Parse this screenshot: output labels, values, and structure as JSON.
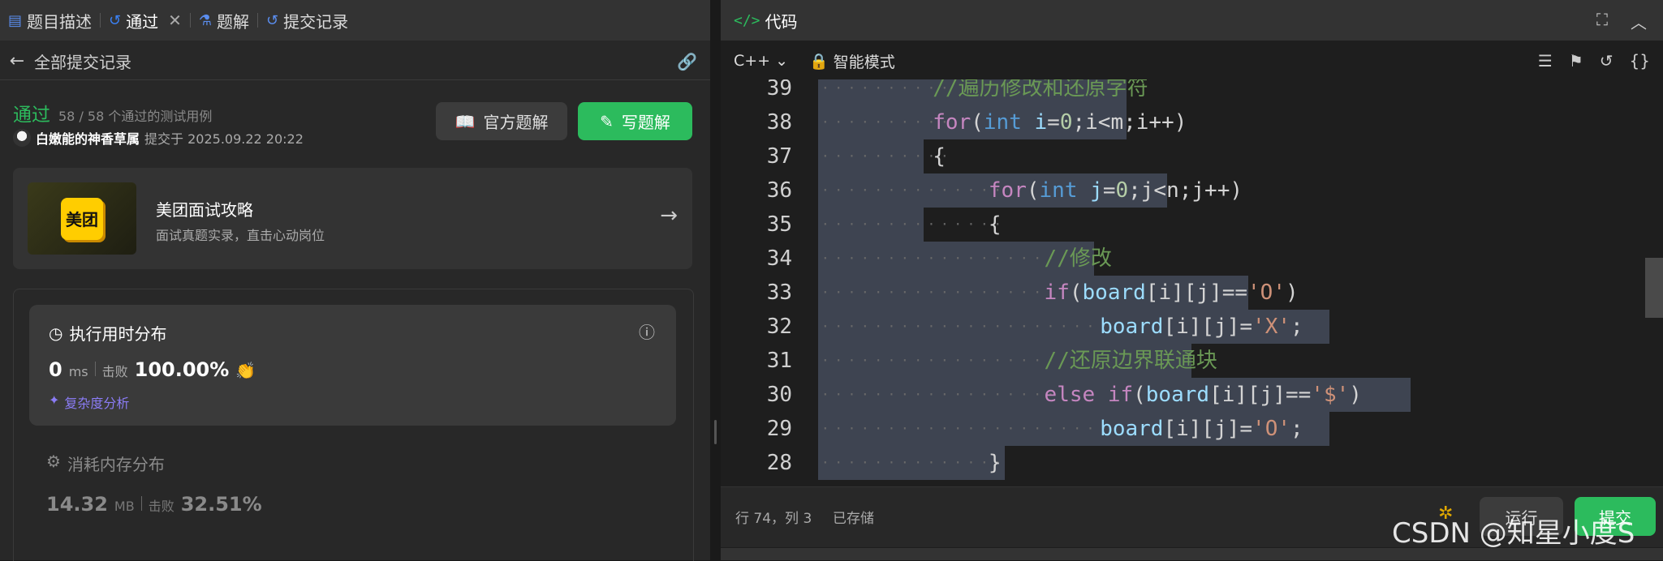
{
  "left_tabs": [
    {
      "label": "题目描述",
      "icon": "description-icon"
    },
    {
      "label": "通过",
      "icon": "history-icon"
    },
    {
      "label": "题解",
      "icon": "flask-icon"
    },
    {
      "label": "提交记录",
      "icon": "history-icon"
    }
  ],
  "back_label": "全部提交记录",
  "submission": {
    "status": "通过",
    "tests": "58 / 58 个通过的测试用例",
    "user": "白嫩能的神香草属",
    "submitted_at": "提交于 2025.09.22 20:22",
    "official_btn": "官方题解",
    "write_btn": "写题解"
  },
  "ad": {
    "logo": "美团",
    "title": "美团面试攻略",
    "subtitle": "面试真题实录，直击心动岗位"
  },
  "runtime": {
    "heading": "执行用时分布",
    "value": "0",
    "unit": "ms",
    "beat_label": "击败",
    "beat": "100.00%",
    "complexity": "复杂度分析"
  },
  "memory": {
    "heading": "消耗内存分布",
    "value": "14.32",
    "unit": "MB",
    "beat_label": "击败",
    "beat": "32.51%"
  },
  "editor": {
    "title": "代码",
    "language": "C++",
    "mode": "智能模式",
    "cursor": "行 74，列 3",
    "saved": "已存储",
    "run": "运行",
    "submit": "提交"
  },
  "code_lines": [
    {
      "n": "39",
      "tokens": [
        [
          "c",
          "//遍历修改和还原字符"
        ]
      ]
    },
    {
      "n": "38",
      "tokens": [
        [
          "k",
          "for"
        ],
        [
          "p",
          "("
        ],
        [
          "t",
          "int"
        ],
        [
          "v",
          " i"
        ],
        [
          "p",
          "="
        ],
        [
          "n",
          "0"
        ],
        [
          "p",
          ";i<m;i++)"
        ]
      ]
    },
    {
      "n": "37",
      "tokens": [
        [
          "p",
          "{"
        ]
      ]
    },
    {
      "n": "36",
      "tokens": [
        [
          "k",
          "for"
        ],
        [
          "p",
          "("
        ],
        [
          "t",
          "int"
        ],
        [
          "v",
          " j"
        ],
        [
          "p",
          "="
        ],
        [
          "n",
          "0"
        ],
        [
          "p",
          ";j<n;j++)"
        ]
      ]
    },
    {
      "n": "35",
      "tokens": [
        [
          "p",
          "{"
        ]
      ]
    },
    {
      "n": "34",
      "tokens": [
        [
          "c",
          "//修改"
        ]
      ]
    },
    {
      "n": "33",
      "tokens": [
        [
          "k",
          "if"
        ],
        [
          "p",
          "("
        ],
        [
          "v",
          "board"
        ],
        [
          "p",
          "[i][j]=="
        ],
        [
          "s",
          "'O'"
        ],
        [
          "p",
          ")"
        ]
      ]
    },
    {
      "n": "32",
      "tokens": [
        [
          "v",
          "board"
        ],
        [
          "p",
          "[i][j]="
        ],
        [
          "s",
          "'X'"
        ],
        [
          "p",
          ";"
        ]
      ]
    },
    {
      "n": "31",
      "tokens": [
        [
          "c",
          "//还原边界联通块"
        ]
      ]
    },
    {
      "n": "30",
      "tokens": [
        [
          "k",
          "else if"
        ],
        [
          "p",
          "("
        ],
        [
          "v",
          "board"
        ],
        [
          "p",
          "[i][j]=="
        ],
        [
          "s",
          "'$'"
        ],
        [
          "p",
          ")"
        ]
      ]
    },
    {
      "n": "29",
      "tokens": [
        [
          "v",
          "board"
        ],
        [
          "p",
          "[i][j]="
        ],
        [
          "s",
          "'O'"
        ],
        [
          "p",
          ";"
        ]
      ]
    },
    {
      "n": "28",
      "tokens": [
        [
          "p",
          "}"
        ]
      ]
    }
  ],
  "watermark": "CSDN @知星小度S"
}
